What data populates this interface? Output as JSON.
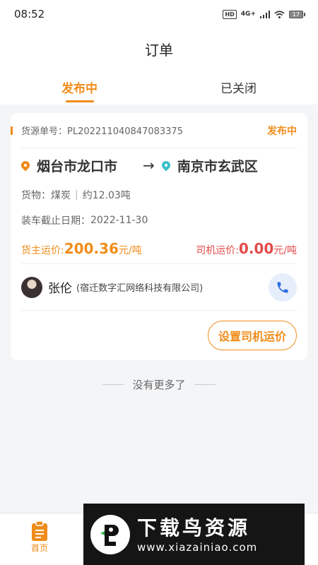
{
  "status_bar": {
    "time": "08:52",
    "hd": "HD",
    "network": "4G+",
    "battery": "17"
  },
  "header": {
    "title": "订单"
  },
  "tabs": [
    {
      "label": "发布中",
      "active": true
    },
    {
      "label": "已关闭",
      "active": false
    }
  ],
  "order": {
    "number_label": "货源单号：",
    "number": "PL202211040847083375",
    "status": "发布中",
    "origin": "烟台市龙口市",
    "destination": "南京市玄武区",
    "cargo_label": "货物：",
    "cargo_type": "煤炭",
    "cargo_weight": "约12.03吨",
    "deadline_label": "装车截止日期：",
    "deadline": "2022-11-30",
    "owner_price_label": "货主运价:",
    "owner_price": "200.36",
    "owner_price_unit": "元/吨",
    "driver_price_label": "司机运价:",
    "driver_price": "0.00",
    "driver_price_unit": "元/吨",
    "contact_name": "张伦",
    "contact_company": "(宿迁数字汇网络科技有限公司)",
    "set_price_button": "设置司机运价"
  },
  "list_end": "没有更多了",
  "tabbar": {
    "home_label": "首页"
  },
  "watermark": {
    "title": "下载鸟资源",
    "url": "www.xiazainiao.com"
  },
  "colors": {
    "accent": "#f08c1a",
    "driver_price": "#e24a4a",
    "destination_pin": "#3bbfc9"
  }
}
